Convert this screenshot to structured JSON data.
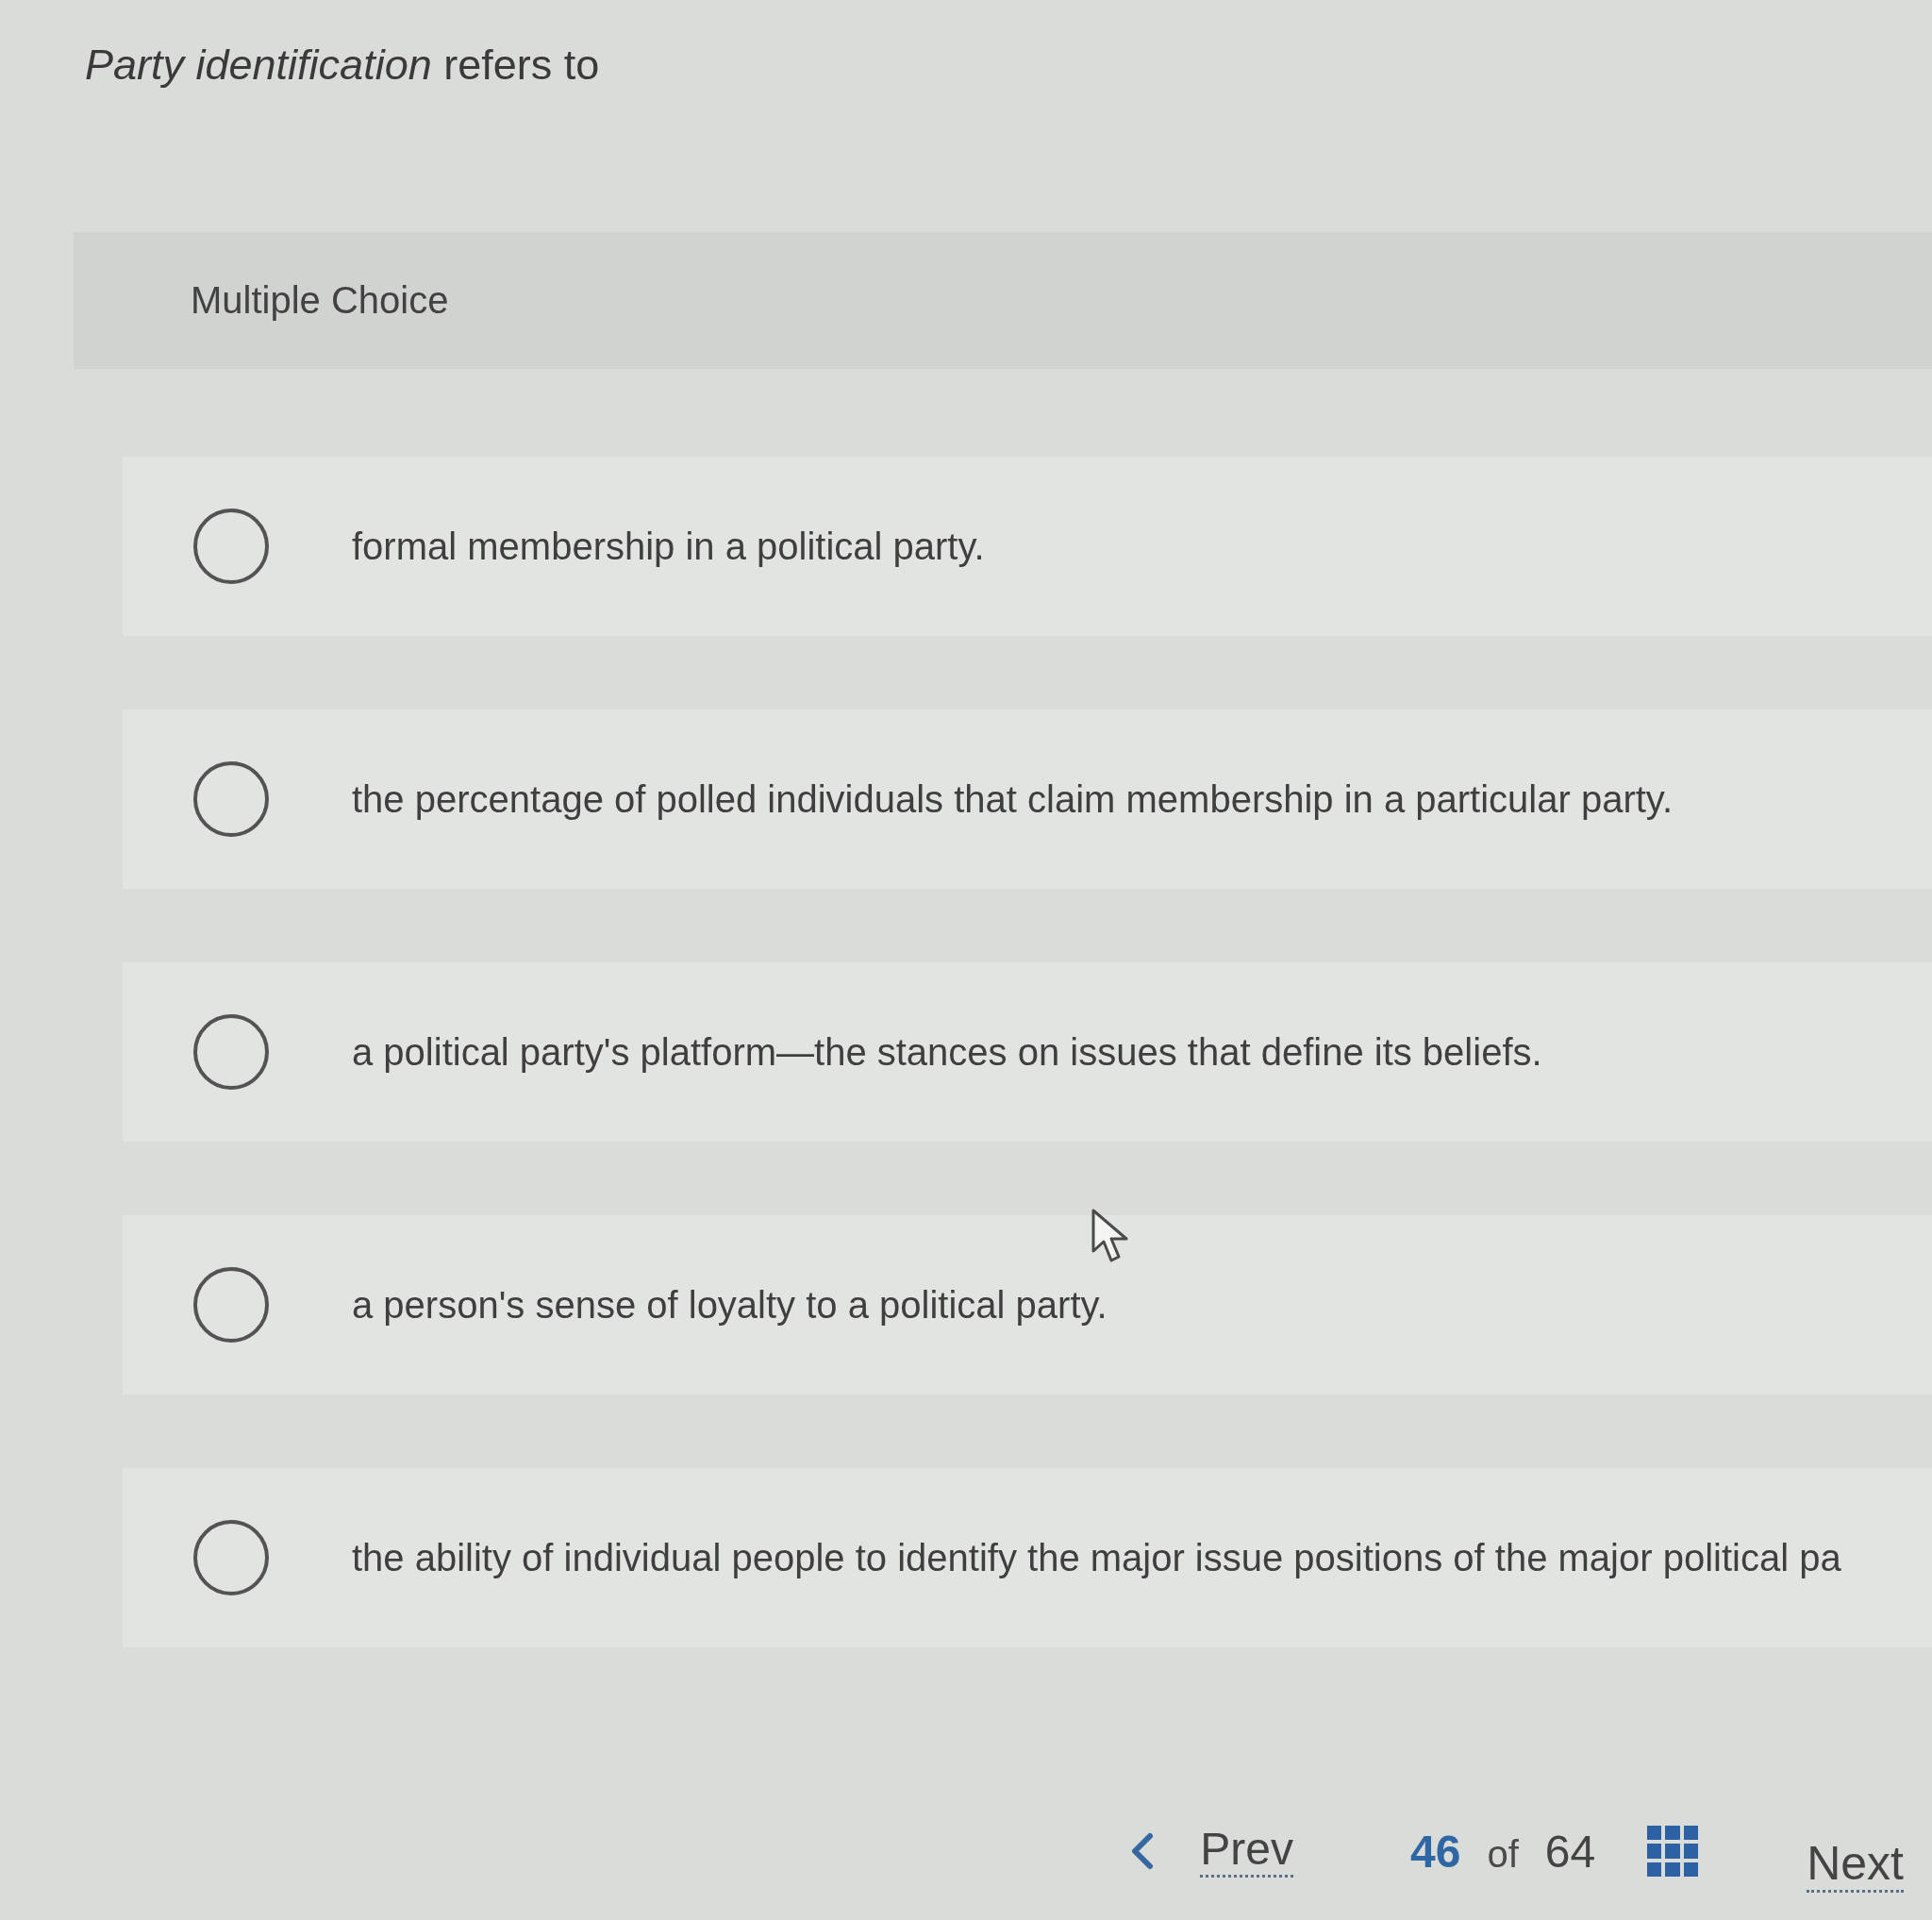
{
  "question": {
    "text": "*Party identification* refers to"
  },
  "question_type": "Multiple Choice",
  "options": [
    {
      "text": "formal membership in a political party.",
      "selected": false
    },
    {
      "text": "the percentage of polled individuals that claim membership in a particular party.",
      "selected": false
    },
    {
      "text": "a political party's platform—the stances on issues that define its beliefs.",
      "selected": false
    },
    {
      "text": "a person's sense of loyalty to a political party.",
      "selected": false
    },
    {
      "text": "the ability of individual people to identify the major issue positions of the major political pa",
      "selected": false
    }
  ],
  "navigation": {
    "prev": "Prev",
    "current": "46",
    "of": "of",
    "total": "64",
    "next": "Next"
  }
}
